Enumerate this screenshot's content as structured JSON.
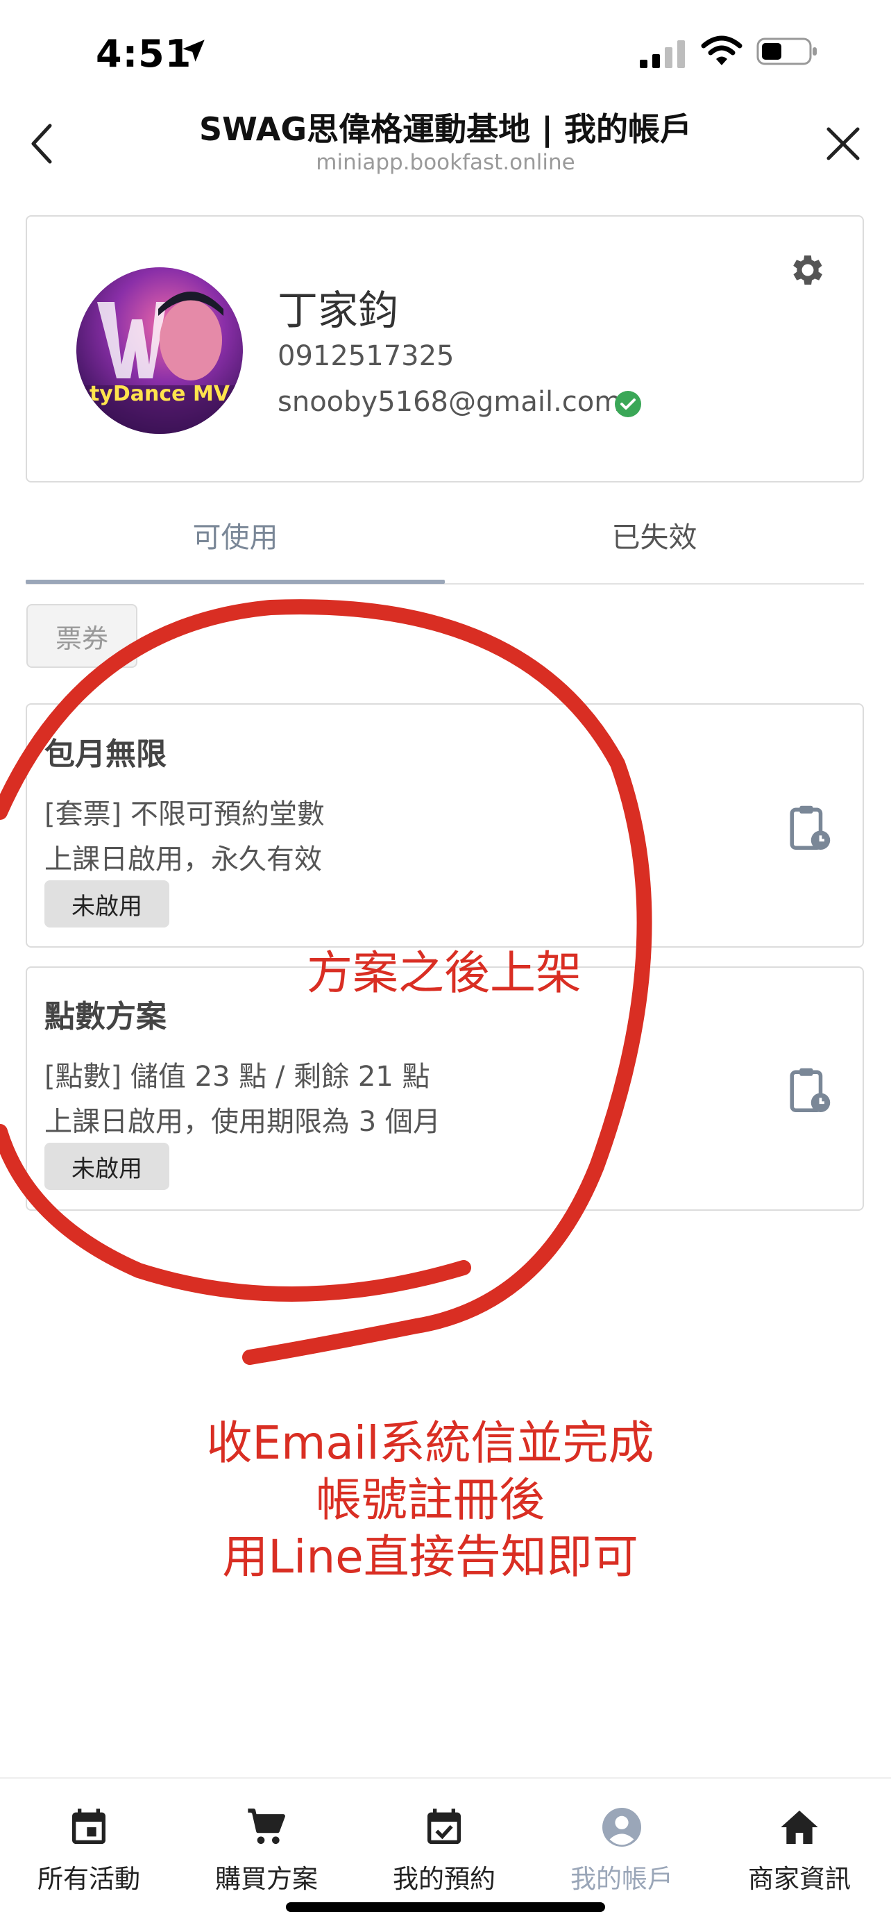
{
  "status_bar": {
    "time": "4:51"
  },
  "header": {
    "title": "SWAG思偉格運動基地 | 我的帳戶",
    "url": "miniapp.bookfast.online"
  },
  "profile": {
    "name": "丁家鈞",
    "phone": "0912517325",
    "email": "snooby5168@gmail.com",
    "avatar_text": "tyDance MV"
  },
  "tabs": [
    {
      "label": "可使用",
      "active": true
    },
    {
      "label": "已失效",
      "active": false
    }
  ],
  "filter_chip": "票券",
  "plans": [
    {
      "title": "包月無限",
      "line1": "[套票] 不限可預約堂數",
      "line2": "上課日啟用，永久有效",
      "status": "未啟用"
    },
    {
      "title": "點數方案",
      "line1": "[點數] 儲值 23 點 / 剩餘 21 點",
      "line2": "上課日啟用，使用期限為 3 個月",
      "status": "未啟用"
    }
  ],
  "annotations": {
    "note1": "方案之後上架",
    "note2_lines": [
      "收Email系統信並完成",
      "帳號註冊後",
      "用Line直接告知即可"
    ],
    "color": "#d92e23"
  },
  "bottom_nav": [
    {
      "label": "所有活動",
      "icon": "calendar-icon",
      "active": false
    },
    {
      "label": "購買方案",
      "icon": "cart-icon",
      "active": false
    },
    {
      "label": "我的預約",
      "icon": "calendar-check-icon",
      "active": false
    },
    {
      "label": "我的帳戶",
      "icon": "account-icon",
      "active": true
    },
    {
      "label": "商家資訊",
      "icon": "home-icon",
      "active": false
    }
  ],
  "colors": {
    "accent": "#9aa6b8",
    "verified": "#3aa757"
  }
}
